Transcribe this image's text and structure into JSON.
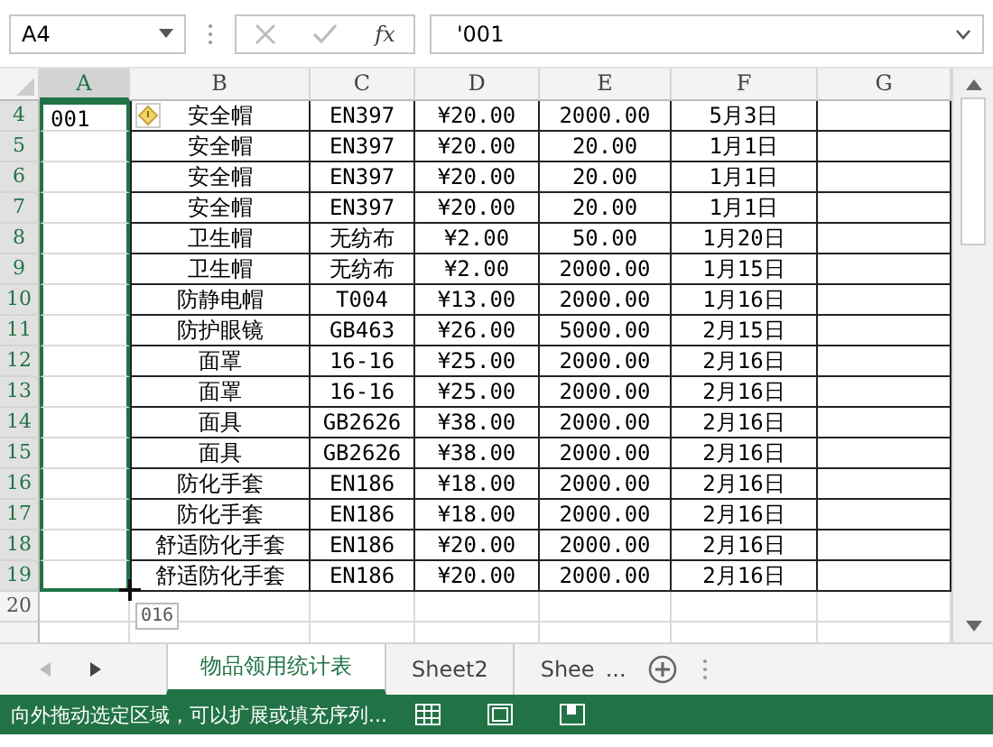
{
  "formula_bar": {
    "name_box": "A4",
    "fx_label": "fx",
    "formula": "'001"
  },
  "columns": [
    {
      "label": "A",
      "selected": true
    },
    {
      "label": "B",
      "selected": false
    },
    {
      "label": "C",
      "selected": false
    },
    {
      "label": "D",
      "selected": false
    },
    {
      "label": "E",
      "selected": false
    },
    {
      "label": "F",
      "selected": false
    },
    {
      "label": "G",
      "selected": false
    }
  ],
  "rows": [
    {
      "number": "4",
      "selected": true,
      "active_value": "001",
      "cells": [
        "安全帽",
        "EN397",
        "¥20.00",
        "2000.00",
        "5月3日"
      ]
    },
    {
      "number": "5",
      "selected": true,
      "cells": [
        "安全帽",
        "EN397",
        "¥20.00",
        "20.00",
        "1月1日"
      ]
    },
    {
      "number": "6",
      "selected": true,
      "cells": [
        "安全帽",
        "EN397",
        "¥20.00",
        "20.00",
        "1月1日"
      ]
    },
    {
      "number": "7",
      "selected": true,
      "cells": [
        "安全帽",
        "EN397",
        "¥20.00",
        "20.00",
        "1月1日"
      ]
    },
    {
      "number": "8",
      "selected": true,
      "cells": [
        "卫生帽",
        "无纺布",
        "¥2.00",
        "50.00",
        "1月20日"
      ]
    },
    {
      "number": "9",
      "selected": true,
      "cells": [
        "卫生帽",
        "无纺布",
        "¥2.00",
        "2000.00",
        "1月15日"
      ]
    },
    {
      "number": "10",
      "selected": true,
      "cells": [
        "防静电帽",
        "T004",
        "¥13.00",
        "2000.00",
        "1月16日"
      ]
    },
    {
      "number": "11",
      "selected": true,
      "cells": [
        "防护眼镜",
        "GB463",
        "¥26.00",
        "5000.00",
        "2月15日"
      ]
    },
    {
      "number": "12",
      "selected": true,
      "cells": [
        "面罩",
        "16-16",
        "¥25.00",
        "2000.00",
        "2月16日"
      ]
    },
    {
      "number": "13",
      "selected": true,
      "cells": [
        "面罩",
        "16-16",
        "¥25.00",
        "2000.00",
        "2月16日"
      ]
    },
    {
      "number": "14",
      "selected": true,
      "cells": [
        "面具",
        "GB2626",
        "¥38.00",
        "2000.00",
        "2月16日"
      ]
    },
    {
      "number": "15",
      "selected": true,
      "cells": [
        "面具",
        "GB2626",
        "¥38.00",
        "2000.00",
        "2月16日"
      ]
    },
    {
      "number": "16",
      "selected": true,
      "cells": [
        "防化手套",
        "EN186",
        "¥18.00",
        "2000.00",
        "2月16日"
      ]
    },
    {
      "number": "17",
      "selected": true,
      "cells": [
        "防化手套",
        "EN186",
        "¥18.00",
        "2000.00",
        "2月16日"
      ]
    },
    {
      "number": "18",
      "selected": true,
      "cells": [
        "舒适防化手套",
        "EN186",
        "¥20.00",
        "2000.00",
        "2月16日"
      ]
    },
    {
      "number": "19",
      "selected": true,
      "cells": [
        "舒适防化手套",
        "EN186",
        "¥20.00",
        "2000.00",
        "2月16日"
      ]
    },
    {
      "number": "20",
      "selected": false,
      "fill_preview": "016"
    }
  ],
  "sheet_tabs": [
    {
      "label": "物品领用统计表",
      "selected": true
    },
    {
      "label": "Sheet2",
      "selected": false
    },
    {
      "label": "Shee",
      "selected": false
    }
  ],
  "more_tabs": "...",
  "status_bar": {
    "message": "向外拖动选定区域，可以扩展或填充序列..."
  }
}
